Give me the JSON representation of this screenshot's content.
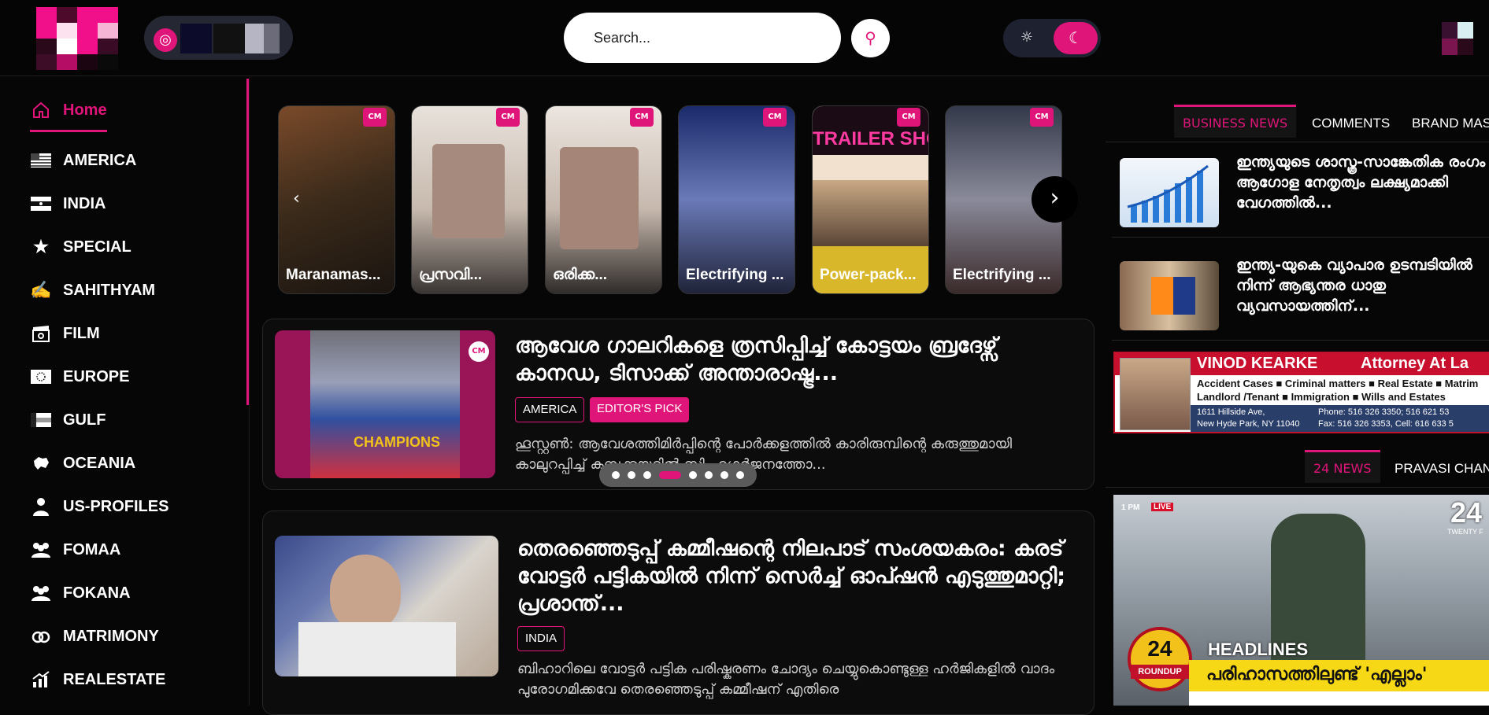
{
  "header": {
    "search_placeholder": "Search...",
    "search_icon": "search-icon",
    "theme_light_icon": "sun-icon",
    "theme_dark_icon": "moon-icon",
    "lang_icon": "globe-icon"
  },
  "sidebar": {
    "items": [
      {
        "label": "Home",
        "icon": "home-icon"
      },
      {
        "label": "AMERICA",
        "icon": "us-flag-icon"
      },
      {
        "label": "INDIA",
        "icon": "india-flag-icon"
      },
      {
        "label": "SPECIAL",
        "icon": "star-icon"
      },
      {
        "label": "SAHITHYAM",
        "icon": "writing-icon"
      },
      {
        "label": "FILM",
        "icon": "clapperboard-icon"
      },
      {
        "label": "EUROPE",
        "icon": "eu-flag-icon"
      },
      {
        "label": "GULF",
        "icon": "uae-flag-icon"
      },
      {
        "label": "OCEANIA",
        "icon": "oceania-map-icon"
      },
      {
        "label": "US-PROFILES",
        "icon": "person-icon"
      },
      {
        "label": "FOMAA",
        "icon": "group-icon"
      },
      {
        "label": "FOKANA",
        "icon": "group-icon"
      },
      {
        "label": "MATRIMONY",
        "icon": "rings-icon"
      },
      {
        "label": "REALESTATE",
        "icon": "chart-growth-icon"
      }
    ]
  },
  "stories": {
    "items": [
      {
        "caption": "Maranamas..."
      },
      {
        "caption": "പ്രസവി..."
      },
      {
        "caption": "ഒരിക്ക..."
      },
      {
        "caption": "Electrifying ..."
      },
      {
        "caption": "Power-pack..."
      },
      {
        "caption": "Electrifying ..."
      }
    ],
    "trailer_banner": "TRAILER SHOW",
    "badge": "CM"
  },
  "featured": {
    "headline": "ആവേശ ഗാലറികളെ ത്രസിപ്പിച്ച് കോട്ടയം ബ്രദേഴ്സ് കാനഡ, ടിസാക്ക് അന്താരാഷ്ട്ര...",
    "tags": [
      "AMERICA",
      "EDITOR'S PICK"
    ],
    "excerpt": "ഹൂസ്റ്റൺ: ആവേശത്തിമിർപ്പിന്റെ പോർക്കളത്തിൽ കാരിരുമ്പിന്റെ കരുത്തുമായി കാലുറപ്പിച്ച് കമ്പക്കയറിൽ സിംഹഗർജനത്തോ...",
    "thumb_text": "CHAMPIONS",
    "slider_total": 9,
    "slider_active": 4
  },
  "article2": {
    "headline": "തെരഞ്ഞെടുപ്പ് കമ്മീഷന്റെ നിലപാട് സംശയകരം: കരട് വോട്ടർ പട്ടികയിൽ നിന്ന് സെർച്ച് ഓപ്ഷൻ എടുത്തുമാറ്റി; പ്രശാന്ത്...",
    "tag": "INDIA",
    "excerpt": "ബിഹാറിലെ വോട്ടർ പട്ടിക പരിഷ്കരണം ചോദ്യം ചെയ്യുകൊണ്ടുള്ള ഹർജികളിൽ വാദം പുരോഗമിക്കവേ തെരഞ്ഞെടുപ്പ് കമ്മീഷന് എതിരെ"
  },
  "right_panel": {
    "tabs1": [
      "BUSINESS NEWS",
      "COMMENTS",
      "BRAND MAS"
    ],
    "business": [
      {
        "headline": "ഇന്ത്യയുടെ ശാസ്ത്ര-സാങ്കേതിക രംഗം ആഗോള നേതൃത്വം ലക്ഷ്യമാക്കി വേഗത്തിൽ..."
      },
      {
        "headline": "ഇന്ത്യ-യുകെ വ്യാപാര ഉടമ്പടിയിൽ നിന്ന് ആഭ്യന്തര ധാതു വ്യവസായത്തിന്..."
      }
    ],
    "ad": {
      "name": "VINOD KEARKE",
      "title": "Attorney At La",
      "services": [
        "Accident Cases",
        "Criminal matters",
        "Real Estate",
        "Matrim",
        "Landlord /Tenant",
        "Immigration",
        "Wills and Estates"
      ],
      "address1": "1611 Hillside Ave,",
      "address2": "New Hyde Park, NY 11040",
      "phone": "Phone: 516 326 3350; 516 621 53",
      "fax": "Fax: 516 326 3353, Cell: 616 633 5"
    },
    "tabs2": [
      "24 NEWS",
      "PRAVASI CHAN"
    ],
    "video": {
      "time": "1 PM",
      "live": "LIVE",
      "brand": "24",
      "brand_sub": "TWENTY F",
      "roundup": "ROUNDUP",
      "headlines": "HEADLINES",
      "ticker": "പരിഹാസത്തിലുണ്ട് 'എല്ലാം'"
    }
  },
  "colors": {
    "accent": "#e0157a",
    "bg": "#060606"
  }
}
